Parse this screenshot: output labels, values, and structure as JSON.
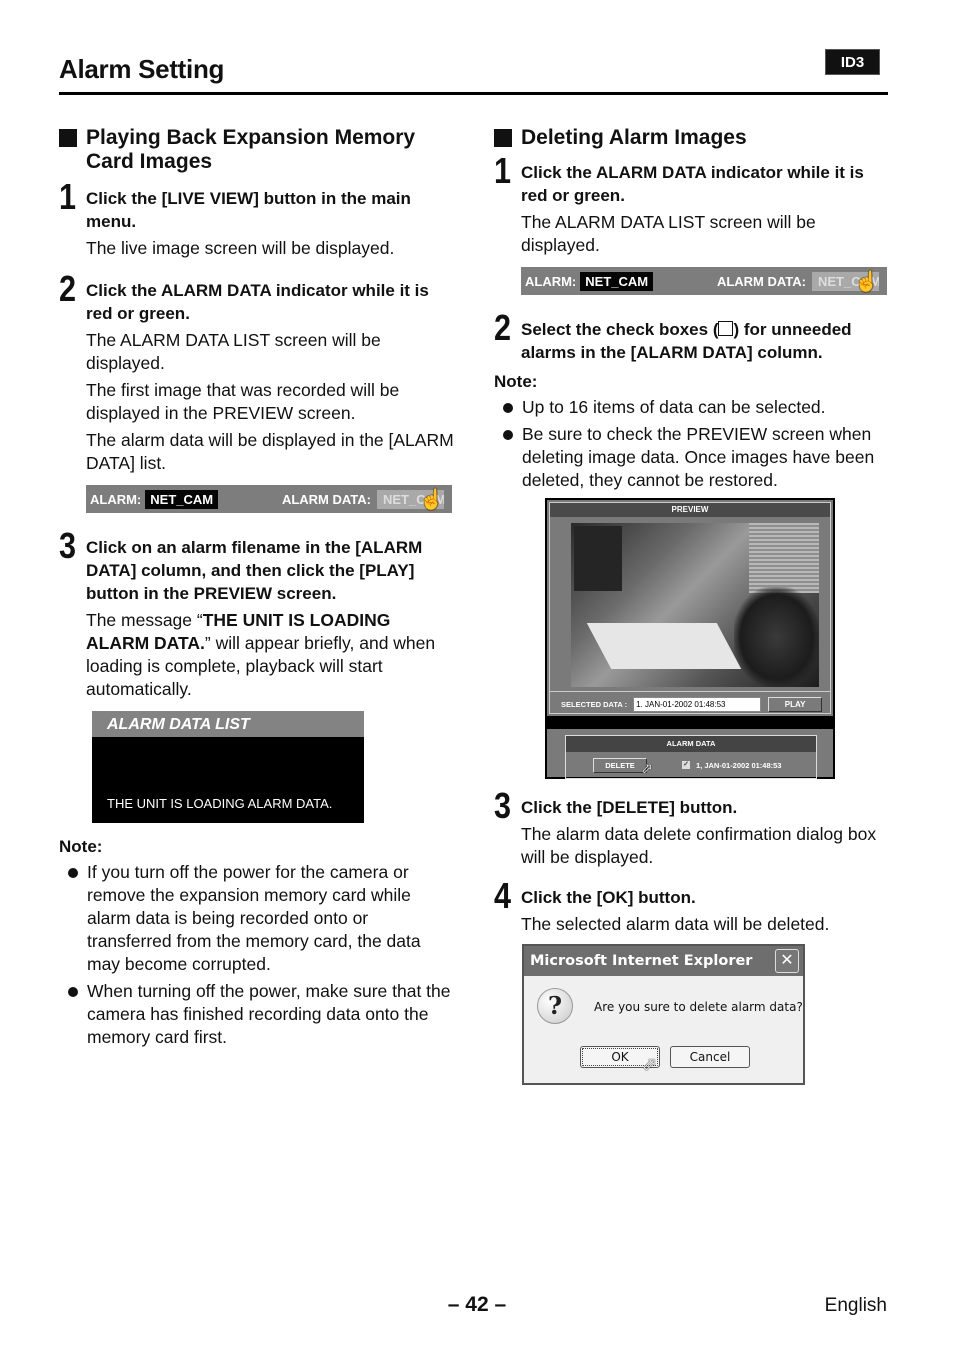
{
  "header": {
    "title": "Alarm Setting",
    "badge": "ID3"
  },
  "left": {
    "section_title": "Playing Back Expansion Memory Card Images",
    "steps": [
      {
        "num": "1",
        "title": "Click the [LIVE VIEW] button in the main menu.",
        "paras": [
          "The live image screen will be displayed."
        ]
      },
      {
        "num": "2",
        "title": "Click the ALARM DATA indicator while it is red or green.",
        "paras": [
          "The ALARM DATA LIST screen will be displayed.",
          "The first image that was recorded will be displayed in the PREVIEW screen.",
          "The alarm data will be displayed in the [ALARM DATA] list."
        ]
      },
      {
        "num": "3",
        "title": "Click on an alarm filename in the [ALARM DATA] column, and then click the [PLAY] button in the PREVIEW screen.",
        "para_prefix": "The message “",
        "para_bold": "THE UNIT IS LOADING ALARM DATA.",
        "para_suffix": "” will appear briefly, and when loading is complete, playback will start automatically."
      }
    ],
    "note_label": "Note:",
    "notes": [
      "If you turn off the power for the camera or remove the expansion memory card while alarm data is being recorded onto or transferred from the memory card, the data may become corrupted.",
      "When turning off the power, make sure that the camera has finished recording data onto the memory card first."
    ],
    "alarm_bar": {
      "alarm_label": "ALARM:",
      "alarm_value": "NET_CAM",
      "data_label": "ALARM DATA:",
      "data_value": "NET_CAM"
    },
    "loading_box": {
      "header": "ALARM DATA LIST",
      "message": "THE UNIT IS LOADING ALARM DATA."
    }
  },
  "right": {
    "section_title": "Deleting Alarm Images",
    "steps": [
      {
        "num": "1",
        "title": "Click the ALARM DATA indicator while it is red or green.",
        "paras": [
          "The ALARM DATA LIST screen will be displayed."
        ]
      },
      {
        "num": "2",
        "title_pre": "Select the check boxes (",
        "title_post": ") for unneeded alarms in the [ALARM DATA] column."
      },
      {
        "num": "3",
        "title": "Click the [DELETE] button.",
        "paras": [
          "The alarm data delete confirmation dialog box will be displayed."
        ]
      },
      {
        "num": "4",
        "title": "Click the [OK] button.",
        "paras": [
          "The selected alarm data will be deleted."
        ]
      }
    ],
    "note_label": "Note:",
    "notes": [
      "Up to 16 items of data can be selected.",
      "Be sure to check the PREVIEW screen when deleting image data. Once images have been deleted, they cannot be restored."
    ],
    "alarm_bar": {
      "alarm_label": "ALARM:",
      "alarm_value": "NET_CAM",
      "data_label": "ALARM DATA:",
      "data_value": "NET_CAM"
    },
    "preview": {
      "header": "PREVIEW",
      "selected_label": "SELECTED DATA :",
      "selected_value": "1. JAN-01-2002 01:48:53",
      "play_label": "PLAY",
      "alarm_data_header": "ALARM DATA",
      "delete_label": "DELETE",
      "item_checked": true,
      "item_label": "1,  JAN-01-2002 01:48:53"
    },
    "dialog": {
      "title": "Microsoft Internet Explorer",
      "message": "Are you sure to delete alarm data?",
      "ok_label": "OK",
      "cancel_label": "Cancel"
    }
  },
  "footer": {
    "page": "– 42 –",
    "language": "English"
  }
}
